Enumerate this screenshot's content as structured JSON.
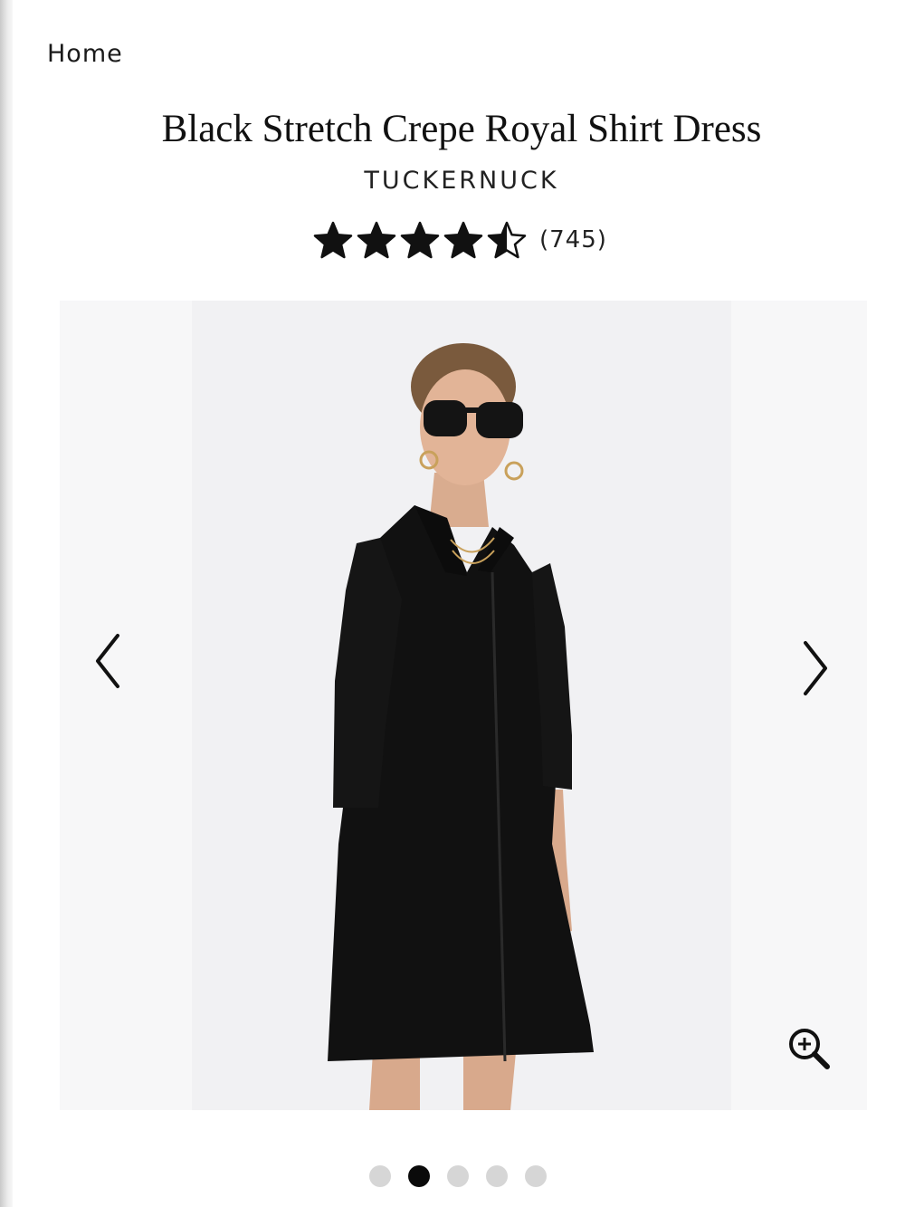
{
  "breadcrumb": {
    "home_label": "Home"
  },
  "product": {
    "title": "Black Stretch Crepe Royal Shirt Dress",
    "brand": "TUCKERNUCK",
    "rating": 4.5,
    "rating_max": 5,
    "review_count": "(745)"
  },
  "gallery": {
    "image_count": 5,
    "active_index": 1,
    "prev_icon": "chevron-left-icon",
    "next_icon": "chevron-right-icon",
    "zoom_icon": "zoom-in-icon"
  },
  "colors": {
    "text": "#111111",
    "gallery_bg": "#f7f7f8",
    "dot_inactive": "#d6d6d6",
    "dot_active": "#0a0a0a"
  }
}
